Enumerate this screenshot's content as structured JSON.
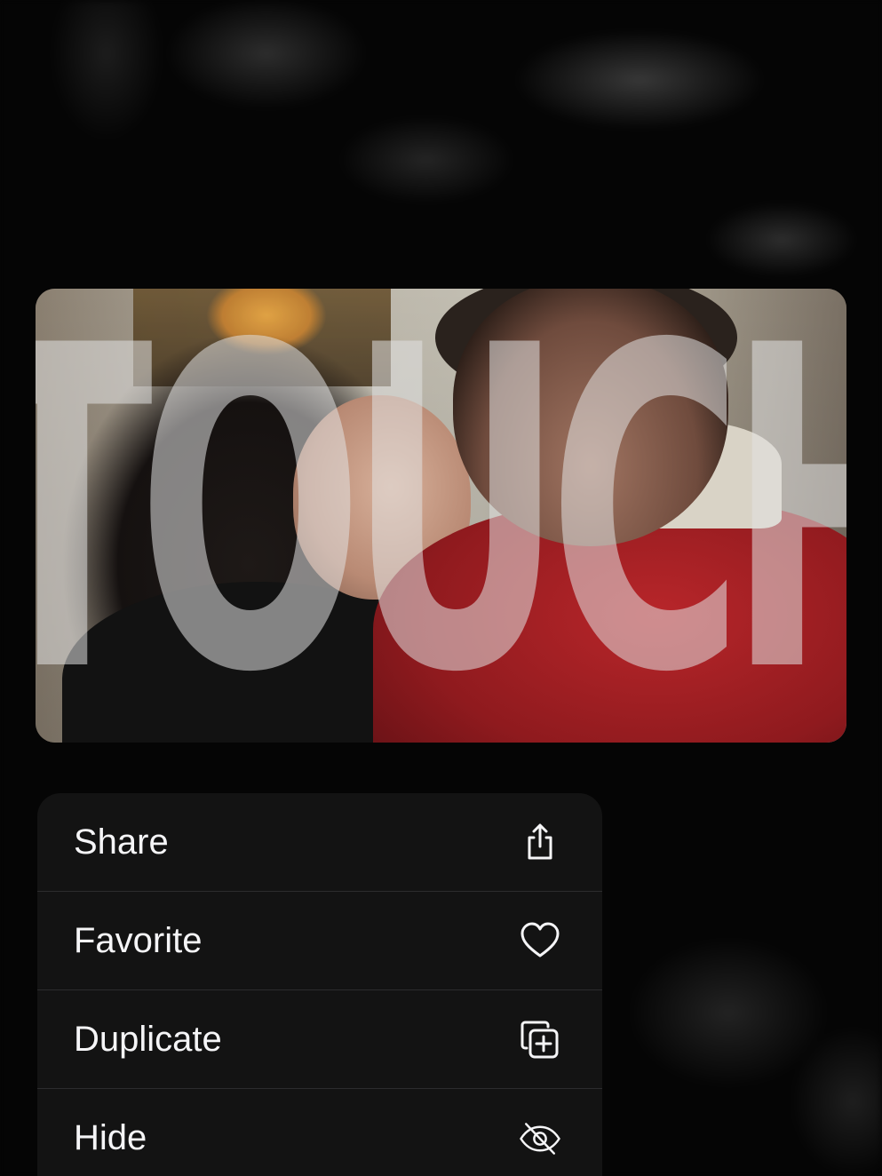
{
  "preview": {
    "overlay_title": "TOUCH"
  },
  "menu": {
    "items": [
      {
        "label": "Share",
        "icon": "share-icon"
      },
      {
        "label": "Favorite",
        "icon": "heart-icon"
      },
      {
        "label": "Duplicate",
        "icon": "duplicate-icon"
      },
      {
        "label": "Hide",
        "icon": "eye-slash-icon"
      }
    ]
  },
  "colors": {
    "background": "#050505",
    "menu_background": "#141414",
    "menu_text": "#f5f5f7",
    "separator": "#2c2c2e"
  }
}
